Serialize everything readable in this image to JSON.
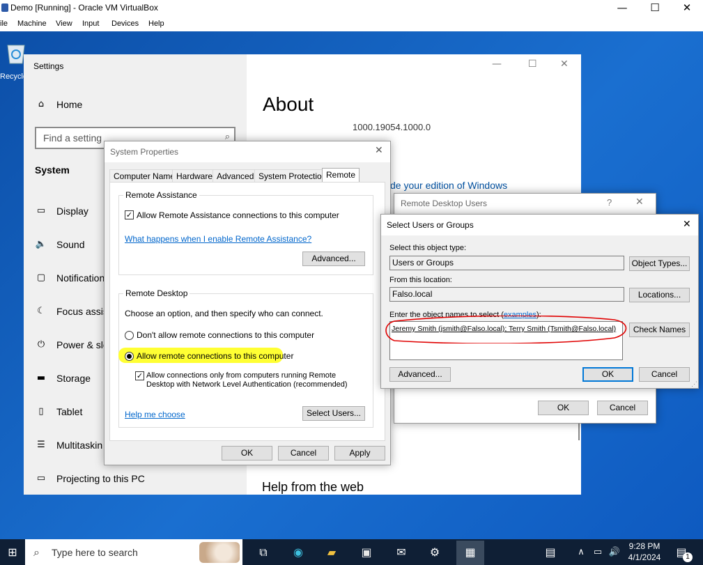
{
  "vbox": {
    "title": "Demo [Running] - Oracle VM VirtualBox",
    "menu": [
      "ile",
      "Machine",
      "View",
      "Input",
      "Devices",
      "Help"
    ]
  },
  "desktop": {
    "recycle_label": "Recycle"
  },
  "settings": {
    "title": "Settings",
    "home": "Home",
    "search_placeholder": "Find a setting",
    "section": "System",
    "nav": [
      {
        "label": "Display",
        "icon": "display-icon"
      },
      {
        "label": "Sound",
        "icon": "sound-icon"
      },
      {
        "label": "Notification",
        "icon": "notification-icon"
      },
      {
        "label": "Focus assist",
        "icon": "focus-assist-icon"
      },
      {
        "label": "Power & sle",
        "icon": "power-icon"
      },
      {
        "label": "Storage",
        "icon": "storage-icon"
      },
      {
        "label": "Tablet",
        "icon": "tablet-icon"
      },
      {
        "label": "Multitaskin",
        "icon": "multitasking-icon"
      },
      {
        "label": "Projecting to this PC",
        "icon": "projecting-icon"
      }
    ],
    "main": {
      "heading": "About",
      "version": "1000.19054.1000.0",
      "upgrade_link": "de your edition of Windows",
      "help_heading": "Help from the web"
    }
  },
  "sysprops": {
    "title": "System Properties",
    "tabs": [
      "Computer Name",
      "Hardware",
      "Advanced",
      "System Protection",
      "Remote"
    ],
    "ra_group": "Remote Assistance",
    "ra_allow": "Allow Remote Assistance connections to this computer",
    "ra_link": "What happens when I enable Remote Assistance?",
    "ra_advanced": "Advanced...",
    "rd_group": "Remote Desktop",
    "rd_intro": "Choose an option, and then specify who can connect.",
    "rd_dont": "Don't allow remote connections to this computer",
    "rd_allow": "Allow remote connections to this computer",
    "rd_nla_1": "Allow connections only from computers running Remote",
    "rd_nla_2": "Desktop with Network Level Authentication (recommended)",
    "help_link": "Help me choose",
    "select_users": "Select Users...",
    "ok": "OK",
    "cancel": "Cancel",
    "apply": "Apply"
  },
  "rdusers": {
    "title": "Remote Desktop Users",
    "help": "?",
    "ok": "OK",
    "cancel": "Cancel"
  },
  "selusers": {
    "title": "Select Users or Groups",
    "obj_type_label": "Select this object type:",
    "obj_type_value": "Users or Groups",
    "obj_types_btn": "Object Types...",
    "location_label": "From this location:",
    "location_value": "Falso.local",
    "locations_btn": "Locations...",
    "names_label": "Enter the object names to select (",
    "names_link": "examples",
    "names_label_end": "):",
    "names_value": "Jeremy Smith (jsmith@Falso.local); Terry Smith (Tsmith@Falso.local)",
    "check_names": "Check Names",
    "advanced": "Advanced...",
    "ok": "OK",
    "cancel": "Cancel"
  },
  "taskbar": {
    "search_placeholder": "Type here to search",
    "time": "9:28 PM",
    "date": "4/1/2024",
    "notif_count": "1"
  },
  "colors": {
    "accent": "#0078d7",
    "highlight": "#ffff33",
    "annotation": "#e00000"
  }
}
